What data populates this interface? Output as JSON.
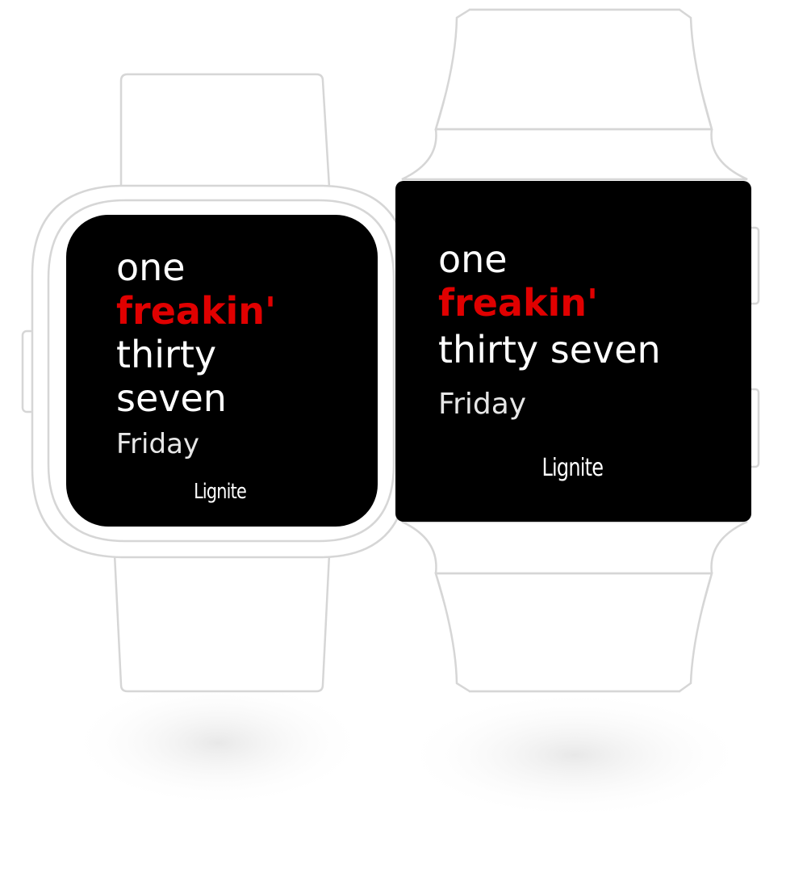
{
  "watch_round": {
    "time_words": [
      "one",
      "freakin'",
      "thirty",
      "seven"
    ],
    "day": "Friday",
    "brand": "Lignite"
  },
  "watch_rect": {
    "time_words": [
      "one",
      "freakin'",
      "thirty seven"
    ],
    "day": "Friday",
    "brand": "Lignite"
  },
  "colors": {
    "background": "#000000",
    "primary_text": "#ffffff",
    "accent": "#e00000",
    "outline": "#d6d6d6"
  }
}
